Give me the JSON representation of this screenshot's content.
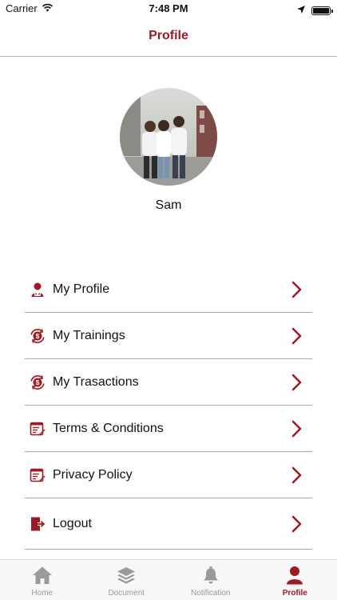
{
  "status_bar": {
    "carrier": "Carrier",
    "time": "7:48 PM"
  },
  "header": {
    "title": "Profile"
  },
  "profile": {
    "name": "Sam"
  },
  "menu": {
    "items": [
      {
        "label": "My Profile",
        "icon": "user-icon"
      },
      {
        "label": "My Trainings",
        "icon": "dollar-refresh-icon"
      },
      {
        "label": "My Trasactions",
        "icon": "dollar-refresh-icon"
      },
      {
        "label": "Terms & Conditions",
        "icon": "document-edit-icon"
      },
      {
        "label": "Privacy Policy",
        "icon": "document-edit-icon"
      },
      {
        "label": "Logout",
        "icon": "logout-icon"
      }
    ]
  },
  "tabs": [
    {
      "label": "Home",
      "icon": "home-icon",
      "active": false
    },
    {
      "label": "Document",
      "icon": "layers-icon",
      "active": false
    },
    {
      "label": "Notification",
      "icon": "bell-icon",
      "active": false
    },
    {
      "label": "Profile",
      "icon": "person-icon",
      "active": true
    }
  ],
  "colors": {
    "accent": "#9b1b25",
    "inactive": "#9a9a9a",
    "divider": "#a9a9a9"
  }
}
